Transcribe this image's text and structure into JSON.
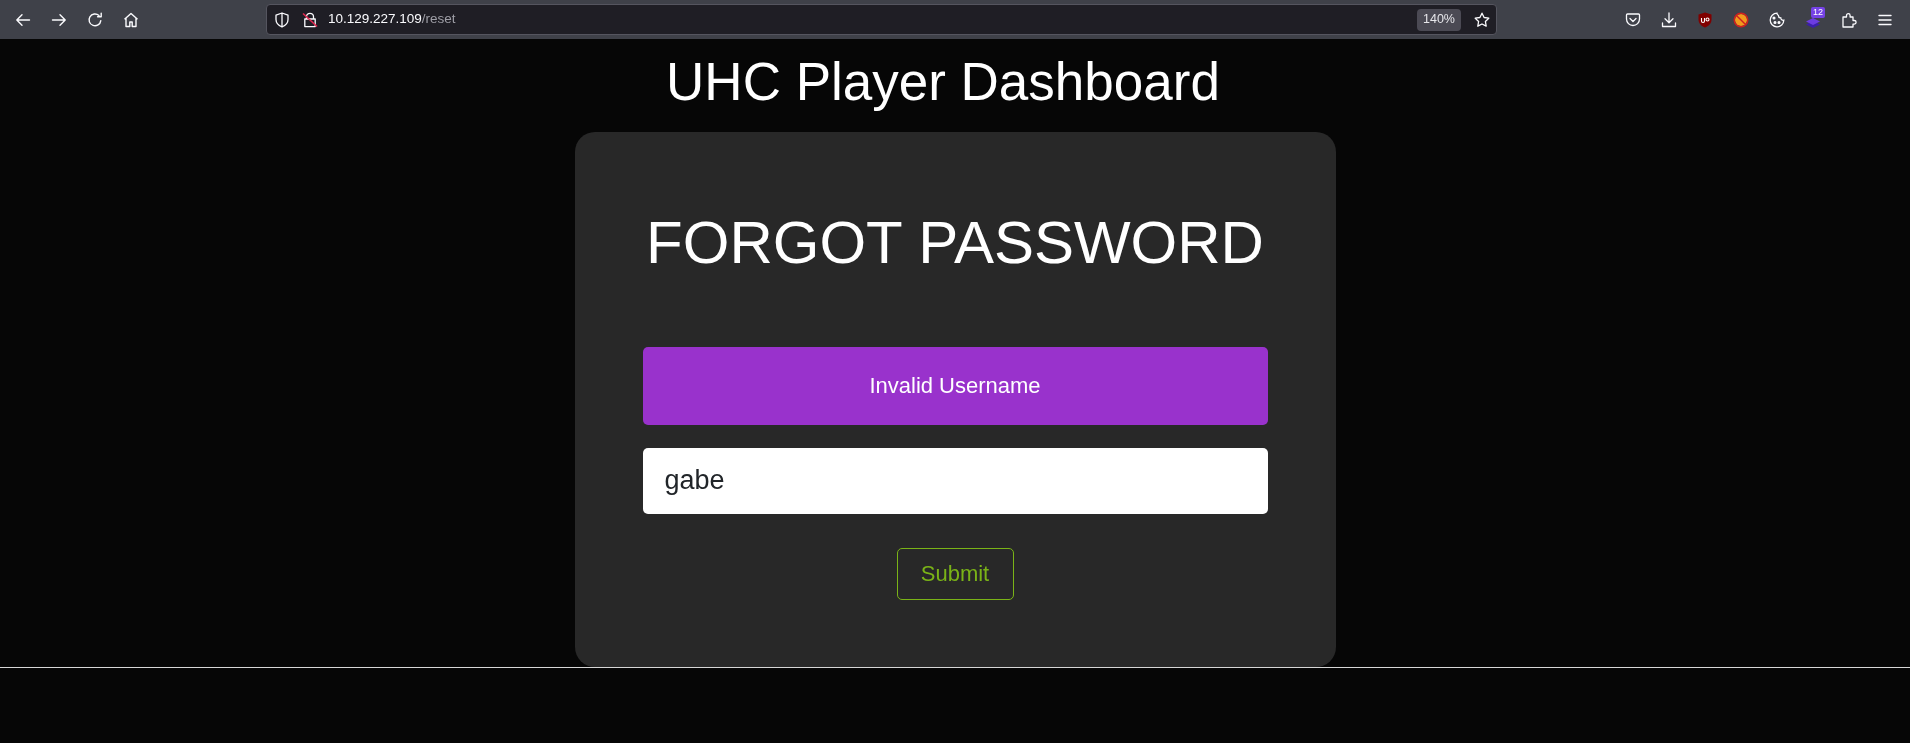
{
  "browser": {
    "url": {
      "host": "10.129.227.109",
      "path": "/reset"
    },
    "zoom": "140%",
    "extension_badge": "12"
  },
  "page": {
    "title": "UHC Player Dashboard",
    "form": {
      "heading": "FORGOT PASSWORD",
      "alert": "Invalid Username",
      "username": {
        "value": "gabe"
      },
      "submit": "Submit"
    }
  }
}
